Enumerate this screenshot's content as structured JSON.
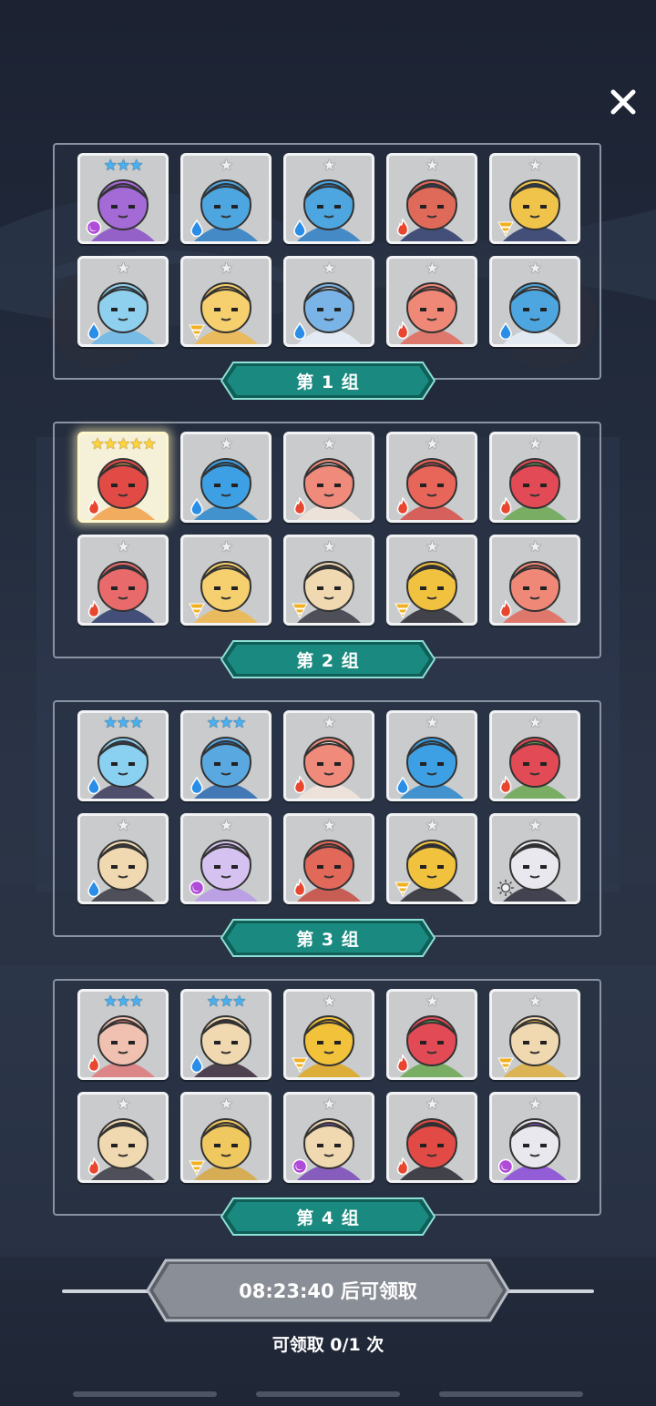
{
  "close_icon": "close-icon",
  "groups": [
    {
      "label": "第 1 组",
      "heroes": [
        {
          "stars": 3,
          "star_color": "blue",
          "element": "dark",
          "color": "#a46ad6",
          "hair": "#8b4fc8"
        },
        {
          "stars": 1,
          "star_color": "grey",
          "element": "water",
          "color": "#4da6e0",
          "hair": "#2b7fc4"
        },
        {
          "stars": 1,
          "star_color": "grey",
          "element": "water",
          "color": "#4da6e0",
          "hair": "#2b7fc4"
        },
        {
          "stars": 1,
          "star_color": "grey",
          "element": "fire",
          "color": "#e06a5a",
          "hair": "#2b3a6a"
        },
        {
          "stars": 1,
          "star_color": "grey",
          "element": "earth",
          "color": "#f0c34a",
          "hair": "#2b3a6a"
        },
        {
          "stars": 1,
          "star_color": "grey",
          "element": "water",
          "color": "#8fd0ee",
          "hair": "#6ab8e8"
        },
        {
          "stars": 1,
          "star_color": "grey",
          "element": "earth",
          "color": "#f6cf6e",
          "hair": "#f0b84a"
        },
        {
          "stars": 1,
          "star_color": "grey",
          "element": "water",
          "color": "#7ab4e6",
          "hair": "#e8f0fa"
        },
        {
          "stars": 1,
          "star_color": "grey",
          "element": "fire",
          "color": "#f08878",
          "hair": "#e26a5c"
        },
        {
          "stars": 1,
          "star_color": "grey",
          "element": "water",
          "color": "#4da6e0",
          "hair": "#e8eef6"
        }
      ]
    },
    {
      "label": "第 2 组",
      "heroes": [
        {
          "stars": 5,
          "star_color": "gold",
          "element": "fire",
          "color": "#e24a46",
          "hair": "#f0a04a",
          "legend": true
        },
        {
          "stars": 1,
          "star_color": "grey",
          "element": "water",
          "color": "#3ea0e4",
          "hair": "#2a88cc"
        },
        {
          "stars": 1,
          "star_color": "grey",
          "element": "fire",
          "color": "#f08a7a",
          "hair": "#f2e6dc"
        },
        {
          "stars": 1,
          "star_color": "grey",
          "element": "fire",
          "color": "#e8655a",
          "hair": "#d84e48"
        },
        {
          "stars": 1,
          "star_color": "grey",
          "element": "fire",
          "color": "#e24a56",
          "hair": "#6aa850"
        },
        {
          "stars": 1,
          "star_color": "grey",
          "element": "fire",
          "color": "#e86a6a",
          "hair": "#2b3a6a"
        },
        {
          "stars": 1,
          "star_color": "grey",
          "element": "earth",
          "color": "#f6cf6e",
          "hair": "#f0b84a"
        },
        {
          "stars": 1,
          "star_color": "grey",
          "element": "earth",
          "color": "#f0d8b0",
          "hair": "#3a3a44"
        },
        {
          "stars": 1,
          "star_color": "grey",
          "element": "earth",
          "color": "#f0c240",
          "hair": "#2a2a34"
        },
        {
          "stars": 1,
          "star_color": "grey",
          "element": "fire",
          "color": "#f08878",
          "hair": "#e26a5c"
        }
      ]
    },
    {
      "label": "第 3 组",
      "heroes": [
        {
          "stars": 3,
          "star_color": "blue",
          "element": "water",
          "color": "#8ad0f0",
          "hair": "#3a3a5a"
        },
        {
          "stars": 3,
          "star_color": "blue",
          "element": "water",
          "color": "#5aa8e0",
          "hair": "#2a6ab0"
        },
        {
          "stars": 1,
          "star_color": "grey",
          "element": "fire",
          "color": "#f08a7a",
          "hair": "#f2e6dc"
        },
        {
          "stars": 1,
          "star_color": "grey",
          "element": "water",
          "color": "#3ea0e4",
          "hair": "#2a88cc"
        },
        {
          "stars": 1,
          "star_color": "grey",
          "element": "fire",
          "color": "#e24a56",
          "hair": "#6aa850"
        },
        {
          "stars": 1,
          "star_color": "grey",
          "element": "water",
          "color": "#f0d8b0",
          "hair": "#3a3a44"
        },
        {
          "stars": 1,
          "star_color": "grey",
          "element": "dark",
          "color": "#d6c2f0",
          "hair": "#b89ae6"
        },
        {
          "stars": 1,
          "star_color": "grey",
          "element": "fire",
          "color": "#e2685a",
          "hair": "#c84a40"
        },
        {
          "stars": 1,
          "star_color": "grey",
          "element": "earth",
          "color": "#f0c23e",
          "hair": "#2a2a34"
        },
        {
          "stars": 1,
          "star_color": "grey",
          "element": "light",
          "color": "#e8e8ee",
          "hair": "#2a2a3a"
        }
      ]
    },
    {
      "label": "第 4 组",
      "heroes": [
        {
          "stars": 3,
          "star_color": "blue",
          "element": "fire",
          "color": "#f0c0b0",
          "hair": "#e07a7a"
        },
        {
          "stars": 3,
          "star_color": "blue",
          "element": "water",
          "color": "#f0d8b0",
          "hair": "#3a2a3a"
        },
        {
          "stars": 1,
          "star_color": "grey",
          "element": "earth",
          "color": "#f2c23a",
          "hair": "#e0a820"
        },
        {
          "stars": 1,
          "star_color": "grey",
          "element": "fire",
          "color": "#e24a56",
          "hair": "#6aa850"
        },
        {
          "stars": 1,
          "star_color": "grey",
          "element": "earth",
          "color": "#f0d8b0",
          "hair": "#e0b040"
        },
        {
          "stars": 1,
          "star_color": "grey",
          "element": "fire",
          "color": "#f0d8b0",
          "hair": "#3a3a44"
        },
        {
          "stars": 1,
          "star_color": "grey",
          "element": "earth",
          "color": "#f0c860",
          "hair": "#d8a840"
        },
        {
          "stars": 1,
          "star_color": "grey",
          "element": "dark",
          "color": "#f0d8b0",
          "hair": "#7a4ab8"
        },
        {
          "stars": 1,
          "star_color": "grey",
          "element": "fire",
          "color": "#e24a46",
          "hair": "#2a2a34"
        },
        {
          "stars": 1,
          "star_color": "grey",
          "element": "dark",
          "color": "#e8e8ee",
          "hair": "#8a4ad8"
        }
      ]
    }
  ],
  "timer_text": "08:23:40 后可领取",
  "claim_text": "可领取 0/1 次",
  "colors": {
    "label_teal": "#1a8a80",
    "label_edge": "#0f5f58",
    "timer_grey": "#8a8e96",
    "water": "#2a8ee8",
    "fire": "#e8462e",
    "earth": "#f0b020",
    "dark": "#b04ad8",
    "light": "#f4f4f4"
  }
}
